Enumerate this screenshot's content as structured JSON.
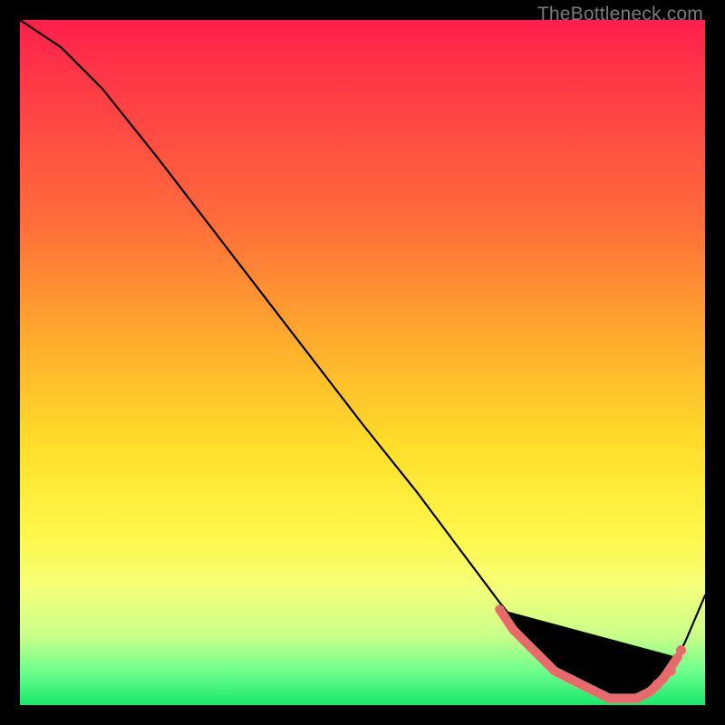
{
  "watermark": "TheBottleneck.com",
  "colors": {
    "marker": "#e86b6b",
    "curve": "#000000"
  },
  "chart_data": {
    "type": "line",
    "title": "",
    "xlabel": "",
    "ylabel": "",
    "xlim": [
      0,
      100
    ],
    "ylim": [
      0,
      100
    ],
    "series": [
      {
        "name": "curve",
        "x": [
          0,
          6,
          12,
          20,
          30,
          40,
          50,
          58,
          64,
          70,
          74,
          78,
          82,
          86,
          90,
          94,
          97,
          100
        ],
        "y": [
          100,
          96,
          90,
          80,
          67,
          54,
          41,
          31,
          23,
          15,
          10,
          6,
          3,
          1,
          1,
          4,
          9,
          16
        ]
      }
    ],
    "markers": {
      "name": "highlight",
      "x": [
        70,
        72,
        74,
        76,
        78,
        80,
        82,
        84,
        86,
        88,
        90,
        92,
        94,
        96
      ],
      "y": [
        14,
        11,
        9,
        7,
        5,
        4,
        3,
        2,
        1,
        1,
        1,
        2,
        4,
        7
      ]
    }
  }
}
